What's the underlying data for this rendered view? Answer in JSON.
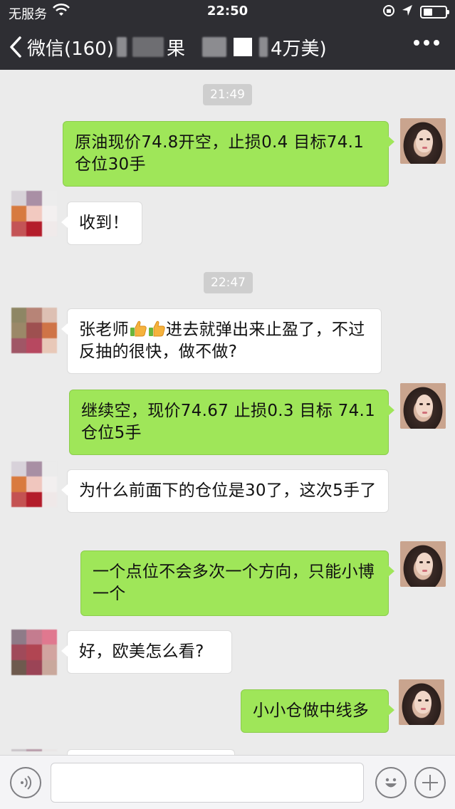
{
  "status_bar": {
    "carrier": "无服务",
    "time": "22:50"
  },
  "nav": {
    "back_label": "微信(160)",
    "title_visible_1": "果",
    "title_visible_2": "4万美)"
  },
  "timestamps": [
    "21:49",
    "22:47"
  ],
  "messages": [
    {
      "side": "right",
      "text": "原油现价74.8开空，止损0.4   目标74.1 仓位30手"
    },
    {
      "side": "left",
      "text": "收到！"
    },
    {
      "side": "left",
      "text_before": "张老师",
      "emoji": [
        "thumbs-up",
        "thumbs-up"
      ],
      "text_after": "进去就弹出来止盈了，不过反抽的很快，做不做?"
    },
    {
      "side": "right",
      "text": "继续空，现价74.67  止损0.3 目标 74.1 仓位5手"
    },
    {
      "side": "left",
      "text": "为什么前面下的仓位是30了，这次5手了"
    },
    {
      "side": "right",
      "text": "一个点位不会多次一个方向，只能小博一个"
    },
    {
      "side": "left",
      "text": "好，欧美怎么看?"
    },
    {
      "side": "right",
      "text": "小小仓做中线多"
    }
  ],
  "colors": {
    "header_bg": "#2e2e33",
    "chat_bg": "#ebebeb",
    "bubble_self": "#9fe659",
    "bubble_other": "#ffffff"
  },
  "icons": {
    "back": "chevron-left-icon",
    "more": "more-dots-icon",
    "voice": "voice-icon",
    "emoji": "emoji-icon",
    "plus": "plus-icon"
  }
}
